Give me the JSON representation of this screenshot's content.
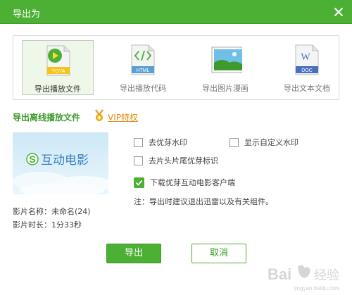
{
  "window": {
    "title": "导出为"
  },
  "formats": [
    {
      "label": "导出播放文件",
      "icon_text": "YOYA",
      "icon": "yoya-play-file-icon",
      "selected": true
    },
    {
      "label": "导出播放代码",
      "icon_text": "HTML",
      "icon": "html-code-file-icon",
      "selected": false
    },
    {
      "label": "导出图片漫画",
      "icon_text": "",
      "icon": "image-comic-icon",
      "selected": false
    },
    {
      "label": "导出文本文档",
      "icon_text": "DOC",
      "icon_letter": "W",
      "icon": "word-doc-icon",
      "selected": false
    }
  ],
  "section": {
    "title": "导出离线播放文件",
    "vip_label": "VIP特权"
  },
  "preview": {
    "logo_text": "互动电影",
    "logo_letter": "S"
  },
  "info": {
    "name": "影片名称：未命名(24)",
    "duration": "影片时长：1分33秒"
  },
  "options": {
    "remove_watermark": {
      "label": "去优芽水印",
      "checked": false
    },
    "custom_watermark": {
      "label": "显示自定义水印",
      "checked": false
    },
    "remove_head_tail": {
      "label": "去片头片尾优芽标识",
      "checked": false
    },
    "download_client": {
      "label": "下载优芽互动电影客户端",
      "checked": true
    }
  },
  "note": "注：导出时建议退出迅雷以及有关组件。",
  "buttons": {
    "export": "导出",
    "cancel": "取消"
  },
  "watermark": {
    "text": "Bai",
    "text2": "经验",
    "url": "jingyan.baidu.com"
  },
  "colors": {
    "accent": "#4cb035",
    "accent_dark": "#3d9a2a",
    "vip": "#e08a10"
  }
}
